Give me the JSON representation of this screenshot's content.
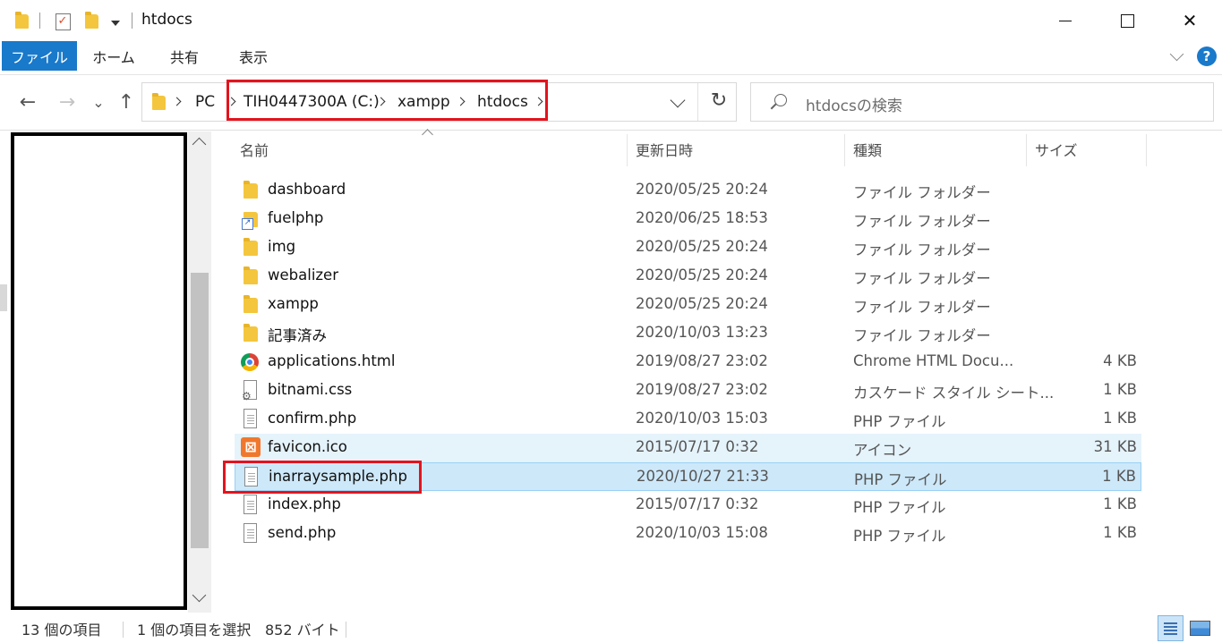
{
  "window": {
    "title": "htdocs",
    "min_glyph": "",
    "close_glyph": "✕"
  },
  "quick_access": {
    "dropdown_glyph": "▾",
    "check_glyph": "✓"
  },
  "ribbon": {
    "tabs": [
      "ファイル",
      "ホーム",
      "共有",
      "表示"
    ],
    "help": "?"
  },
  "nav": {
    "back": "←",
    "forward": "→",
    "recent": "⌄",
    "up": "↑",
    "refresh": "↻"
  },
  "address": {
    "crumbs": [
      "PC",
      "TIH0447300A (C:)",
      "xampp",
      "htdocs"
    ]
  },
  "search": {
    "placeholder": "htdocsの検索"
  },
  "columns": {
    "name": "名前",
    "modified": "更新日時",
    "type": "種類",
    "size": "サイズ"
  },
  "files": [
    {
      "name": "dashboard",
      "modified": "2020/05/25 20:24",
      "type": "ファイル フォルダー",
      "size": "",
      "icon": "folder-icon"
    },
    {
      "name": "fuelphp",
      "modified": "2020/06/25 18:53",
      "type": "ファイル フォルダー",
      "size": "",
      "icon": "folder-shortcut-icon"
    },
    {
      "name": "img",
      "modified": "2020/05/25 20:24",
      "type": "ファイル フォルダー",
      "size": "",
      "icon": "folder-icon"
    },
    {
      "name": "webalizer",
      "modified": "2020/05/25 20:24",
      "type": "ファイル フォルダー",
      "size": "",
      "icon": "folder-icon"
    },
    {
      "name": "xampp",
      "modified": "2020/05/25 20:24",
      "type": "ファイル フォルダー",
      "size": "",
      "icon": "folder-icon"
    },
    {
      "name": "記事済み",
      "modified": "2020/10/03 13:23",
      "type": "ファイル フォルダー",
      "size": "",
      "icon": "folder-icon"
    },
    {
      "name": "applications.html",
      "modified": "2019/08/27 23:02",
      "type": "Chrome HTML Docu...",
      "size": "4 KB",
      "icon": "chrome-icon"
    },
    {
      "name": "bitnami.css",
      "modified": "2019/08/27 23:02",
      "type": "カスケード スタイル シート...",
      "size": "1 KB",
      "icon": "css-file-icon"
    },
    {
      "name": "confirm.php",
      "modified": "2020/10/03 15:03",
      "type": "PHP ファイル",
      "size": "1 KB",
      "icon": "document-icon"
    },
    {
      "name": "favicon.ico",
      "modified": "2015/07/17 0:32",
      "type": "アイコン",
      "size": "31 KB",
      "icon": "xampp-icon"
    },
    {
      "name": "inarraysample.php",
      "modified": "2020/10/27 21:33",
      "type": "PHP ファイル",
      "size": "1 KB",
      "icon": "document-icon"
    },
    {
      "name": "index.php",
      "modified": "2015/07/17 0:32",
      "type": "PHP ファイル",
      "size": "1 KB",
      "icon": "document-icon"
    },
    {
      "name": "send.php",
      "modified": "2020/10/03 15:08",
      "type": "PHP ファイル",
      "size": "1 KB",
      "icon": "document-icon"
    }
  ],
  "status": {
    "item_count": "13 個の項目",
    "selection": "1 個の項目を選択",
    "selection_size": "852 バイト"
  },
  "colors": {
    "accent": "#1979ca",
    "selection_bg": "#cde8f9",
    "hover_bg": "#e5f3fb",
    "annotation_red": "#e4131d"
  }
}
